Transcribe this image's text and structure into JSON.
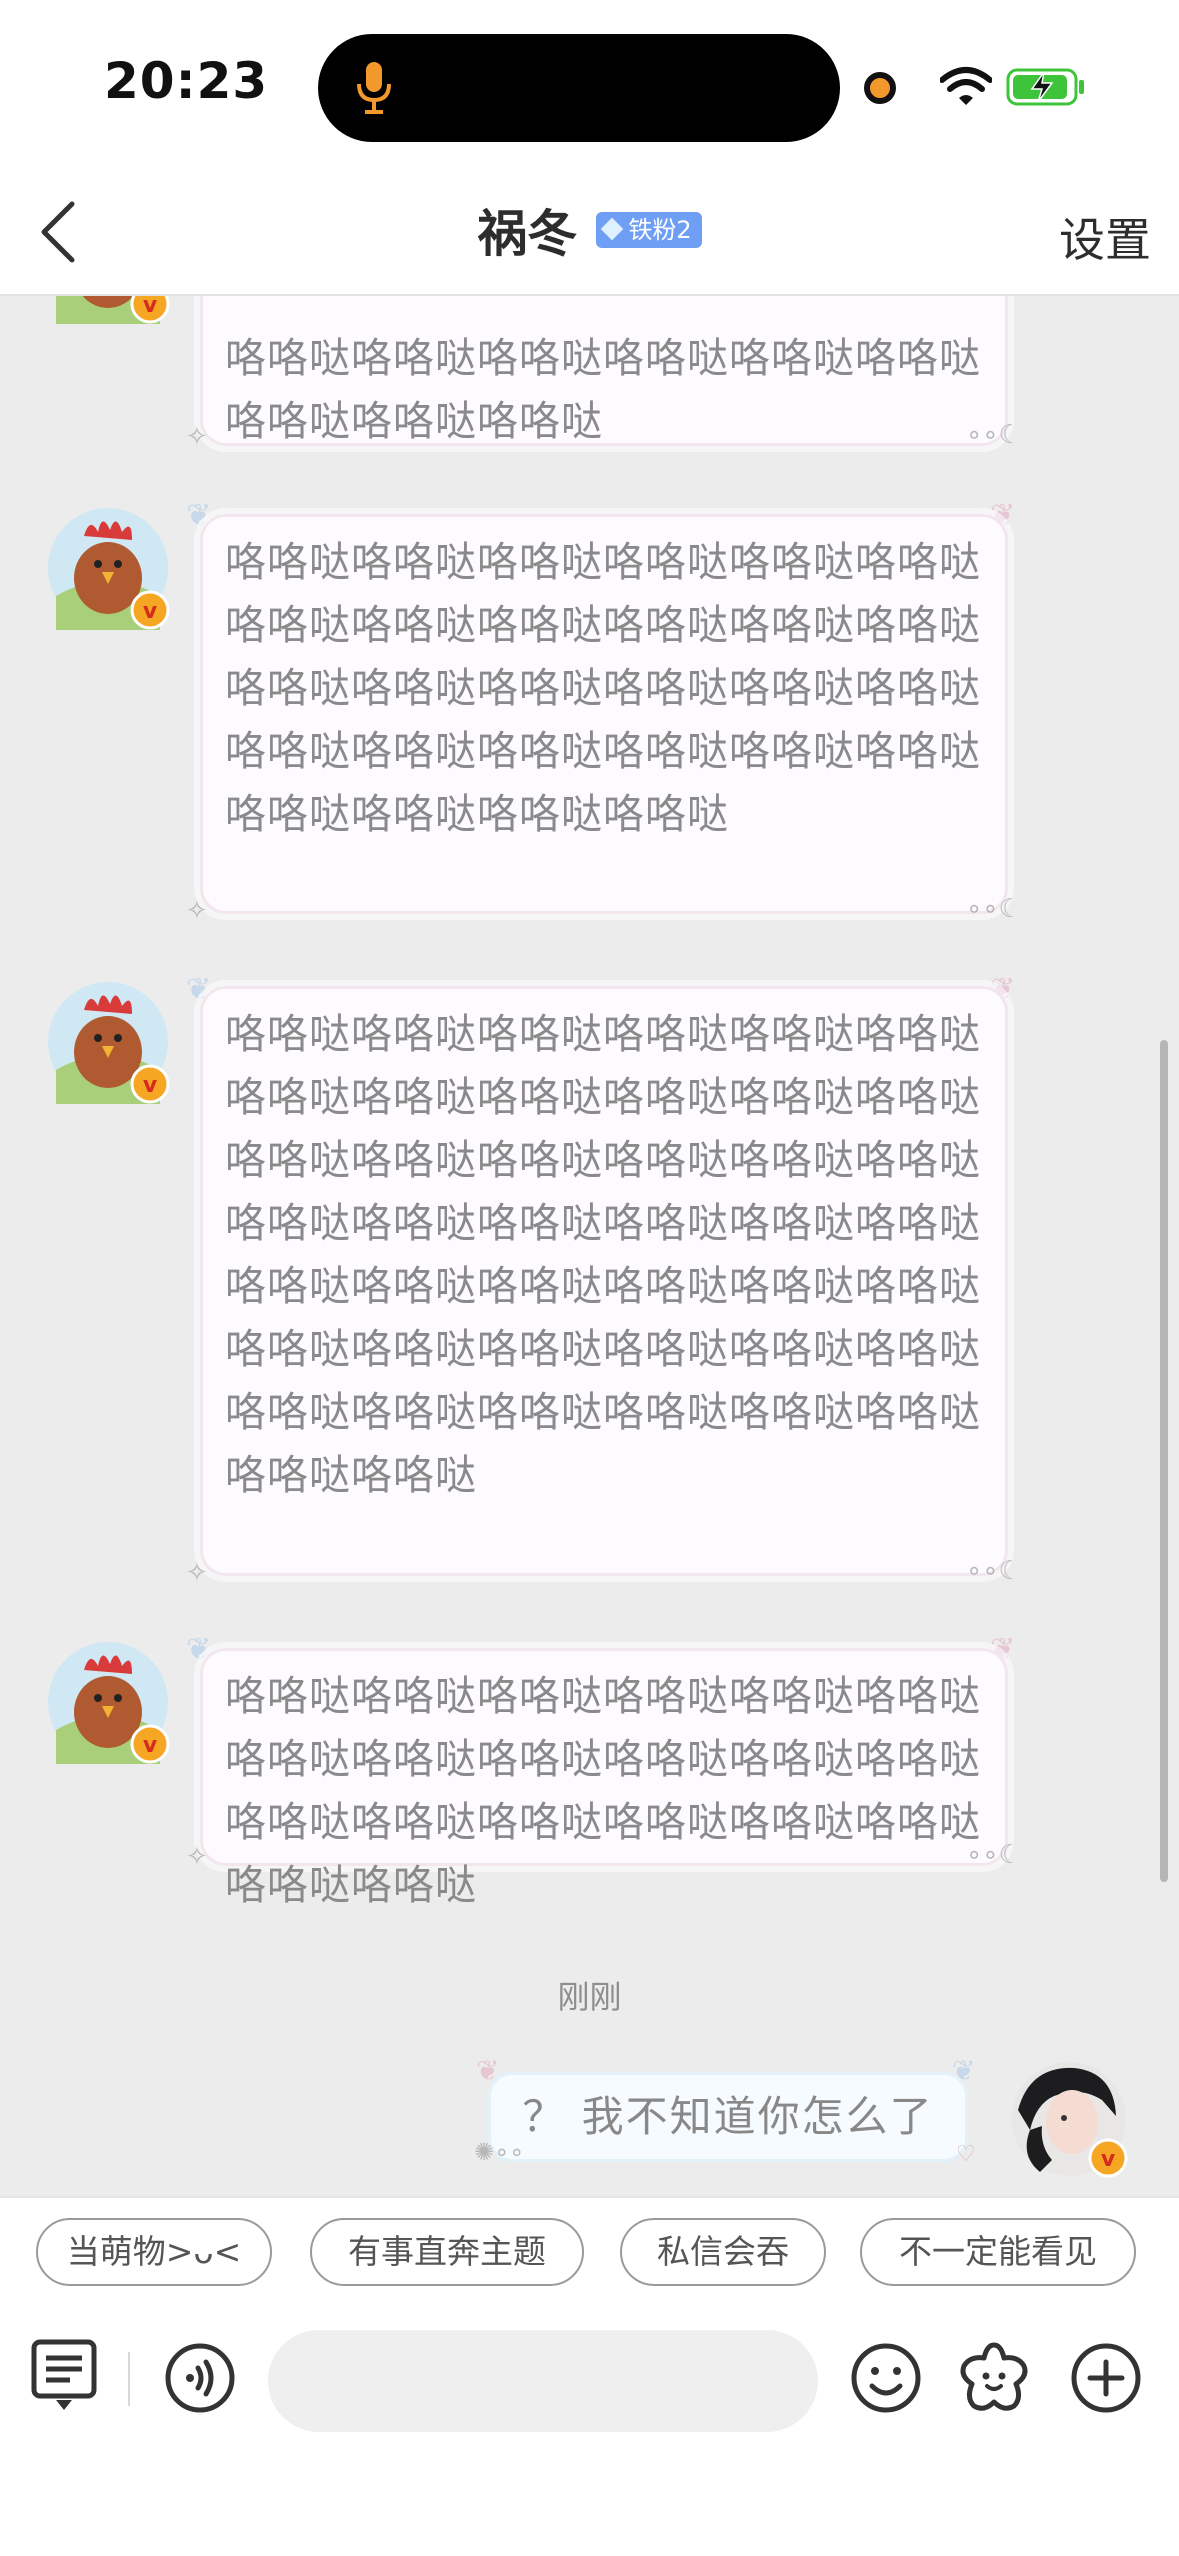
{
  "status_bar": {
    "time": "20:23",
    "icons": [
      "mic-icon",
      "camera-indicator-icon",
      "wifi-icon",
      "battery-charging-icon"
    ],
    "colors": {
      "mic": "#f3982b",
      "battery": "#3ec43a"
    }
  },
  "nav": {
    "title": "祸冬",
    "badge": "铁粉2",
    "settings_label": "设置",
    "back_icon": "chevron-left-icon"
  },
  "messages": [
    {
      "side": "left",
      "text": "咯咯哒咯咯哒咯咯哒咯咯哒咯咯哒咯咯哒咯咯哒咯咯哒咯咯哒"
    },
    {
      "side": "left",
      "text": "咯咯哒咯咯哒咯咯哒咯咯哒咯咯哒咯咯哒咯咯哒咯咯哒咯咯哒咯咯哒咯咯哒咯咯哒咯咯哒咯咯哒咯咯哒咯咯哒咯咯哒咯咯哒咯咯哒咯咯哒咯咯哒咯咯哒咯咯哒咯咯哒咯咯哒咯咯哒咯咯哒咯咯哒"
    },
    {
      "side": "left",
      "text": "咯咯哒咯咯哒咯咯哒咯咯哒咯咯哒咯咯哒咯咯哒咯咯哒咯咯哒咯咯哒咯咯哒咯咯哒咯咯哒咯咯哒咯咯哒咯咯哒咯咯哒咯咯哒咯咯哒咯咯哒咯咯哒咯咯哒咯咯哒咯咯哒咯咯哒咯咯哒咯咯哒咯咯哒咯咯哒咯咯哒咯咯哒咯咯哒咯咯哒咯咯哒咯咯哒咯咯哒咯咯哒咯咯哒咯咯哒咯咯哒咯咯哒咯咯哒咯咯哒咯咯哒"
    },
    {
      "side": "left",
      "text": "咯咯哒咯咯哒咯咯哒咯咯哒咯咯哒咯咯哒咯咯哒咯咯哒咯咯哒咯咯哒咯咯哒咯咯哒咯咯哒咯咯哒咯咯哒咯咯哒咯咯哒咯咯哒咯咯哒咯咯哒"
    },
    {
      "side": "right",
      "text": "？ 我不知道你怎么了"
    }
  ],
  "timestamp": "刚刚",
  "quick_replies": [
    "当萌物>ᴗ<",
    "有事直奔主题",
    "私信会吞",
    "不一定能看见"
  ],
  "input_bar": {
    "icons": [
      "menu-keyboard-icon",
      "voice-icon",
      "emoji-icon",
      "sticker-icon",
      "plus-icon"
    ],
    "placeholder": ""
  }
}
